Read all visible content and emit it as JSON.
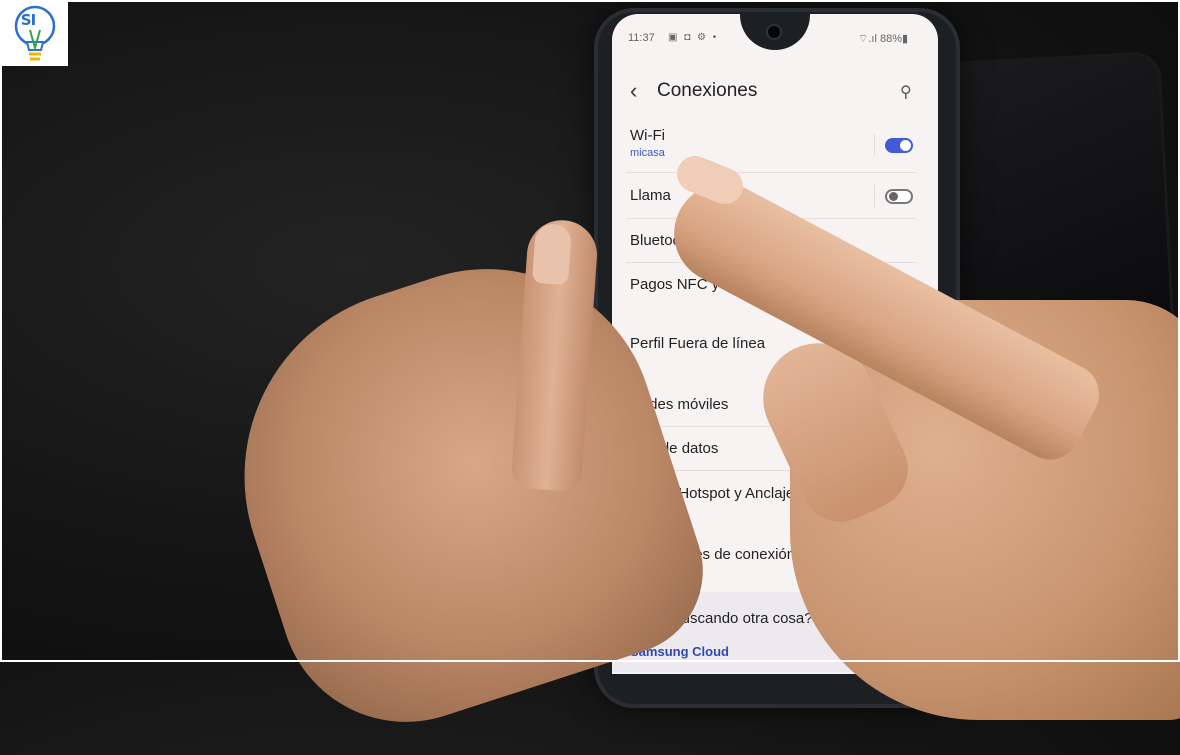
{
  "logo": {
    "text": "SI"
  },
  "status_bar": {
    "time": "11:37",
    "icons": "▣ ◘ ⚙ •",
    "right": "⌔.ıl 88%▮"
  },
  "header": {
    "back_glyph": "‹",
    "title": "Conexiones",
    "search_glyph": "⚲"
  },
  "settings_items": [
    {
      "label": "Wi-Fi",
      "sub": "micasa",
      "toggle": "on"
    },
    {
      "label": "Llama",
      "toggle": "off"
    },
    {
      "label": "Bluetooth"
    },
    {
      "label": "Pagos NFC y sin c"
    },
    {
      "label": "Perfil Fuera de línea"
    },
    {
      "label": "Redes móviles"
    },
    {
      "label": "Uso de datos"
    },
    {
      "label": "Mobile Hotspot y Anclaje a red"
    },
    {
      "label": "Más ajustes de conexión"
    }
  ],
  "suggestion_card": {
    "question": "¿Está buscando otra cosa?",
    "link": "Samsung Cloud"
  },
  "colors": {
    "accent": "#3f5bd8",
    "screen_bg": "#f7f3f3"
  }
}
